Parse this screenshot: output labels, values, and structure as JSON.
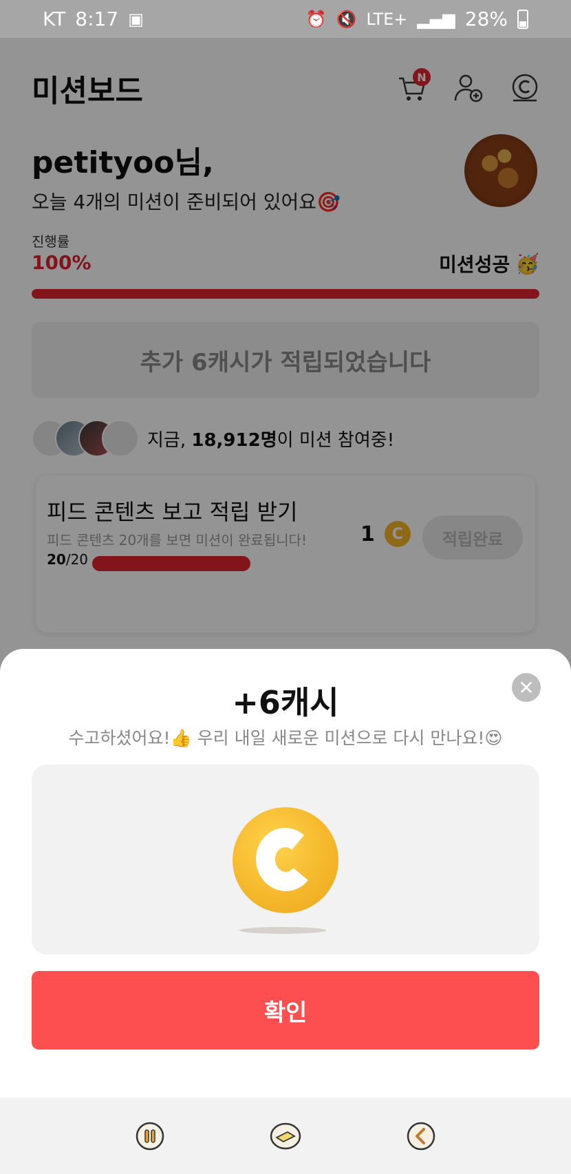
{
  "status_bar": {
    "carrier": "KT",
    "time": "8:17",
    "network": "LTE+",
    "battery": "28%"
  },
  "header": {
    "title": "미션보드",
    "cart_badge": "N"
  },
  "greeting": {
    "name": "petityoo님,",
    "subtitle": "오늘 4개의 미션이 준비되어 있어요🎯"
  },
  "progress": {
    "label": "진행률",
    "value": "100%",
    "fraction": 1.0,
    "status": "미션성공",
    "status_emoji": "🥳"
  },
  "bonus": {
    "text": "추가 6캐시가 적립되었습니다"
  },
  "participants": {
    "prefix": "지금, ",
    "count": "18,912명",
    "suffix": "이 미션 참여중!"
  },
  "missions": [
    {
      "title": "피드 콘텐츠 보고 적립 받기",
      "description": "피드 콘텐츠 20개를 보면 미션이 완료됩니다!",
      "done": "20",
      "total": "/20",
      "reward": "1",
      "coin_letter": "C",
      "button": "적립완료"
    }
  ],
  "sheet": {
    "title": "+6캐시",
    "subtitle": "수고하셨어요!👍 우리 내일 새로운 미션으로 다시 만나요!😍",
    "confirm": "확인"
  },
  "icons": {
    "cart": "cart-icon",
    "add_friend": "add-friend-icon",
    "cash": "cash-icon",
    "close": "close-icon",
    "nav_recent": "recent-apps-icon",
    "nav_home": "home-icon",
    "nav_back": "back-icon"
  },
  "colors": {
    "accent": "#e0242f",
    "confirm_button": "#fd4f4f",
    "coin": "#f4b62a"
  }
}
